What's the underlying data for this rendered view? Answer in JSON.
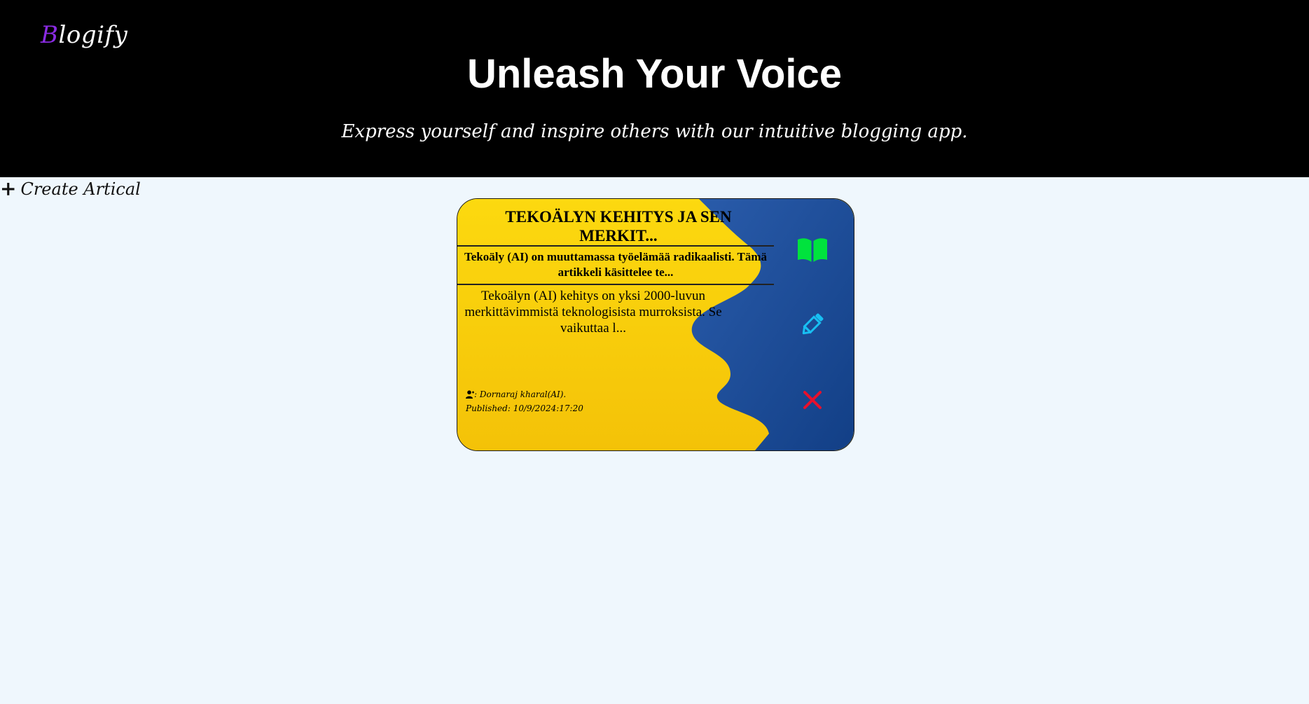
{
  "header": {
    "logo_first_letter": "B",
    "logo_rest": "logify",
    "logo_accent_color": "#8a2be2",
    "title": "Unleash Your Voice",
    "subtitle": "Express yourself and inspire others with our intuitive blogging app."
  },
  "actions": {
    "create_label": "Create Artical",
    "create_icon": "plus-icon"
  },
  "articles": [
    {
      "title": "TEKOÄLYN KEHITYS JA SEN MERKIT...",
      "summary": "Tekoäly (AI) on muuttamassa työelämää radikaalisti. Tämä artikkeli käsittelee te...",
      "body": "Tekoälyn (AI) kehitys on yksi 2000-luvun merkittävimmistä teknologisista murroksista. Se vaikuttaa l...",
      "author_suffix": ": Dornaraj kharal(AI).",
      "published": "Published: 10/9/2024:17:20",
      "icons": {
        "read": "book-open-icon",
        "edit": "pencil-icon",
        "delete": "close-icon"
      },
      "colors": {
        "left_bg": "#f8cf10",
        "right_bg": "#1f4e9a",
        "read_icon": "#00e33d",
        "edit_icon": "#18bff2",
        "delete_icon": "#e8102c"
      }
    }
  ]
}
